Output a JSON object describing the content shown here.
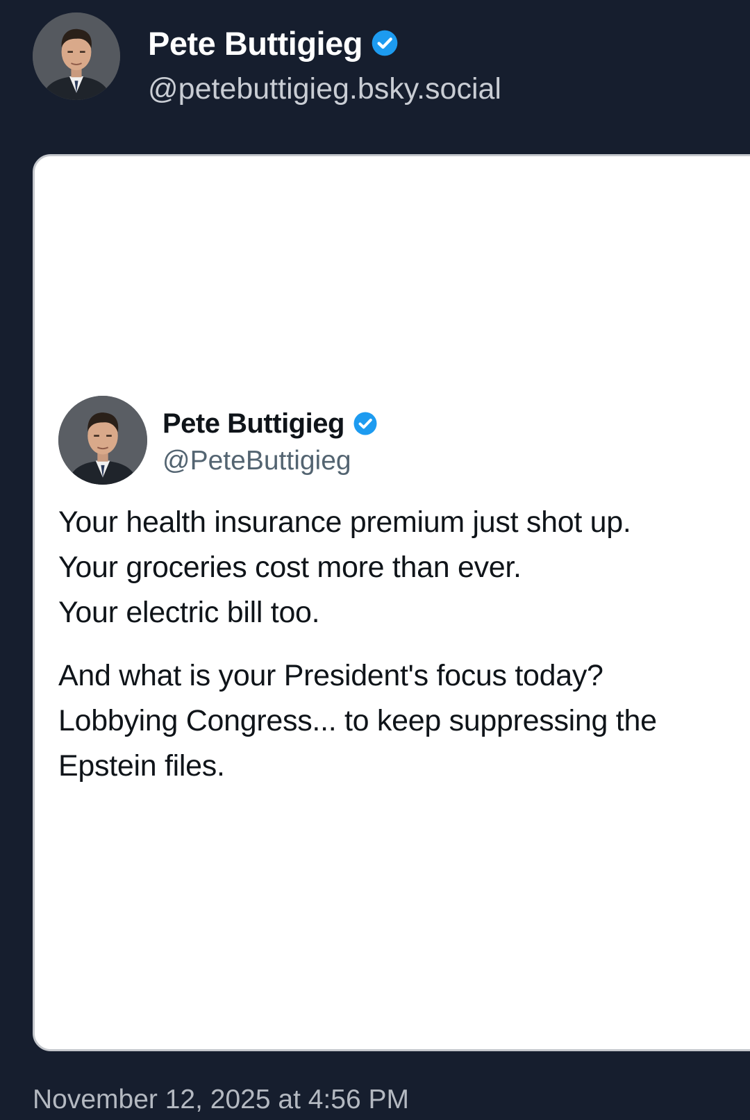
{
  "post": {
    "author": {
      "name": "Pete Buttigieg",
      "handle": "@petebuttigieg.bsky.social",
      "verified": true
    },
    "timestamp": "November 12, 2025 at 4:56 PM"
  },
  "embedded_tweet": {
    "author": {
      "name": "Pete Buttigieg",
      "handle": "@PeteButtigieg",
      "verified": true
    },
    "paragraphs": [
      {
        "lines": [
          "Your health insurance premium just shot up.",
          "Your groceries cost more than ever.",
          "Your electric bill too."
        ]
      },
      {
        "lines": [
          "And what is your President's focus today?",
          "Lobbying Congress... to keep suppressing the",
          "Epstein files."
        ]
      }
    ]
  },
  "colors": {
    "background": "#161e2e",
    "card": "#ffffff",
    "verified_badge": "#1d9bf0",
    "outer_name": "#ffffff",
    "outer_handle": "#c9cdd4",
    "inner_handle": "#536471"
  },
  "icons": {
    "verified": "verified-badge-icon"
  }
}
